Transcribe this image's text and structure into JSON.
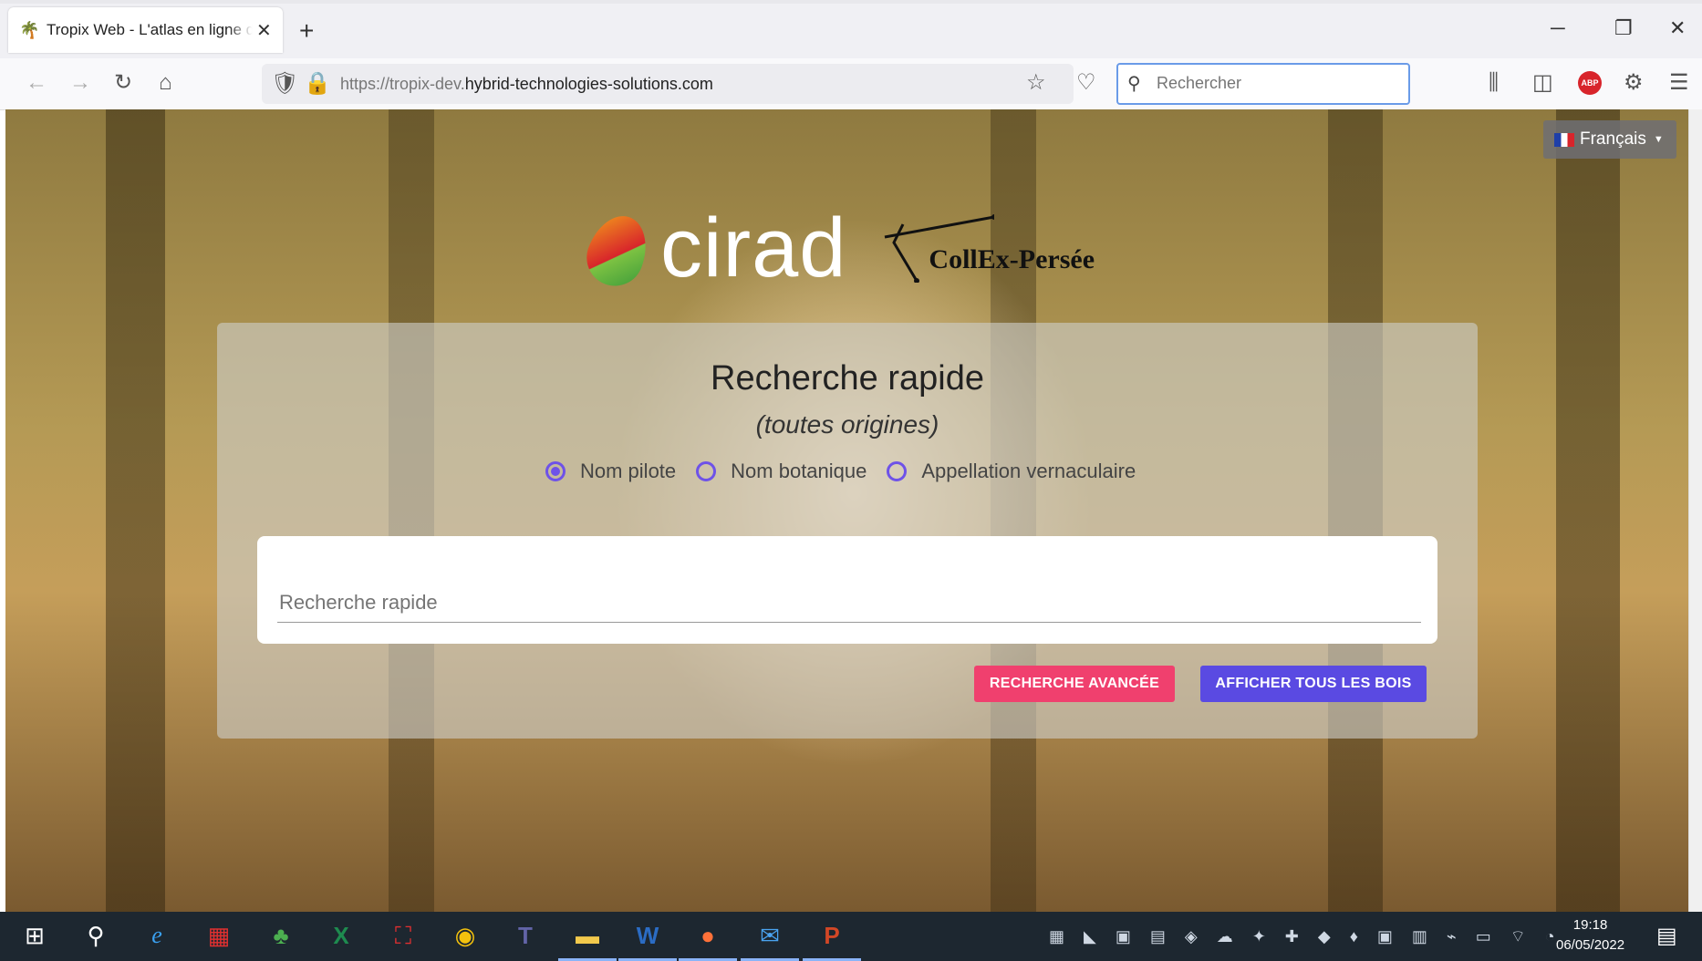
{
  "browser": {
    "tab_title": "Tropix Web - L'atlas en ligne des bois tropicaux",
    "tab_close": "✕",
    "new_tab": "+",
    "url_prefix": "https://tropix-dev.",
    "url_domain": "hybrid-technologies-solutions.com",
    "search_placeholder": "Rechercher",
    "adblock_label": "ABP"
  },
  "page": {
    "language": "Français",
    "logo_text": "cirad",
    "partner_text": "CollEx-Persée",
    "title": "Recherche rapide",
    "subtitle": "(toutes origines)",
    "radio_options": [
      "Nom pilote",
      "Nom botanique",
      "Appellation vernaculaire"
    ],
    "selected_radio": "Nom pilote",
    "search_placeholder": "Recherche rapide",
    "btn_advanced": "RECHERCHE AVANCÉE",
    "btn_all": "AFFICHER TOUS LES BOIS"
  },
  "taskbar": {
    "time": "19:18",
    "date": "06/05/2022"
  },
  "colors": {
    "accent_pink": "#f0406e",
    "accent_purple": "#5a4ae2",
    "radio": "#6e52e8"
  }
}
